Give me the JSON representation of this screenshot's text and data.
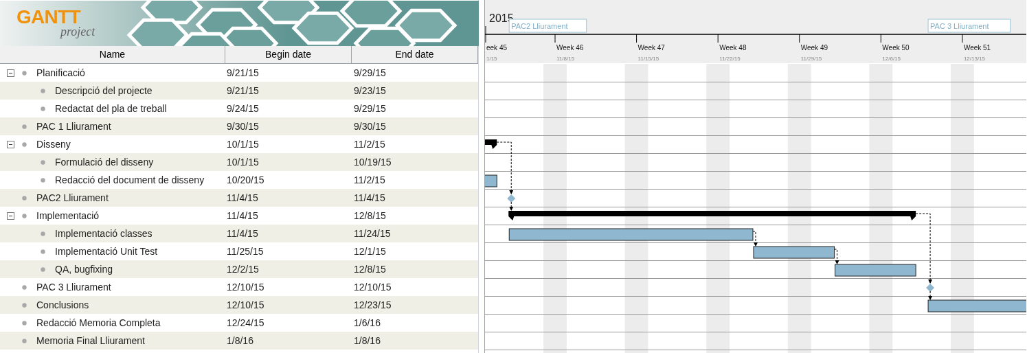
{
  "logo": {
    "word": "GANTT",
    "subword": "project"
  },
  "table": {
    "columns": [
      "Name",
      "Begin date",
      "End date"
    ],
    "tasks": [
      {
        "name": "Planificació",
        "begin": "9/21/15",
        "end": "9/29/15",
        "kind": "summary",
        "expanded": true,
        "has_predecessor": false,
        "children": [
          {
            "name": "Descripció del projecte",
            "begin": "9/21/15",
            "end": "9/23/15",
            "kind": "task",
            "has_predecessor": false
          },
          {
            "name": "Redactat del pla de treball",
            "begin": "9/24/15",
            "end": "9/29/15",
            "kind": "task",
            "has_predecessor": false
          }
        ]
      },
      {
        "name": "PAC 1 Lliurament",
        "begin": "9/30/15",
        "end": "9/30/15",
        "kind": "milestone",
        "has_predecessor": false
      },
      {
        "name": "Disseny",
        "begin": "10/1/15",
        "end": "11/2/15",
        "kind": "summary",
        "expanded": true,
        "has_predecessor": false,
        "children": [
          {
            "name": "Formulació del disseny",
            "begin": "10/1/15",
            "end": "10/19/15",
            "kind": "task",
            "has_predecessor": false
          },
          {
            "name": "Redacció del document de disseny",
            "begin": "10/20/15",
            "end": "11/2/15",
            "kind": "task",
            "has_predecessor": false
          }
        ]
      },
      {
        "name": "PAC2 Lliurament",
        "begin": "11/4/15",
        "end": "11/4/15",
        "kind": "milestone",
        "has_predecessor": true,
        "header_label": "PAC2 Lliurament"
      },
      {
        "name": "Implementació",
        "begin": "11/4/15",
        "end": "12/8/15",
        "kind": "summary",
        "expanded": true,
        "has_predecessor": true,
        "children": [
          {
            "name": "Implementació classes",
            "begin": "11/4/15",
            "end": "11/24/15",
            "kind": "task",
            "has_predecessor": false
          },
          {
            "name": "Implementació Unit Test",
            "begin": "11/25/15",
            "end": "12/1/15",
            "kind": "task",
            "has_predecessor": true
          },
          {
            "name": "QA, bugfixing",
            "begin": "12/2/15",
            "end": "12/8/15",
            "kind": "task",
            "has_predecessor": true
          }
        ]
      },
      {
        "name": "PAC 3 Lliurament",
        "begin": "12/10/15",
        "end": "12/10/15",
        "kind": "milestone",
        "has_predecessor": true,
        "header_label": "PAC 3 Lliurament"
      },
      {
        "name": "Conclusions",
        "begin": "12/10/15",
        "end": "12/23/15",
        "kind": "task",
        "has_predecessor": true
      },
      {
        "name": "Redacció Memoria Completa",
        "begin": "12/24/15",
        "end": "1/6/16",
        "kind": "task",
        "has_predecessor": false
      },
      {
        "name": "Memoria Final Lliurament",
        "begin": "1/8/16",
        "end": "1/8/16",
        "kind": "milestone",
        "has_predecessor": false
      }
    ]
  },
  "timeline": {
    "year": "2015",
    "weeks": [
      {
        "label": "eek 45",
        "date": "1/15"
      },
      {
        "label": "Week 46",
        "date": "11/8/15"
      },
      {
        "label": "Week 47",
        "date": "11/15/15"
      },
      {
        "label": "Week 48",
        "date": "11/22/15"
      },
      {
        "label": "Week 49",
        "date": "11/29/15"
      },
      {
        "label": "Week 50",
        "date": "12/6/15"
      },
      {
        "label": "Week 51",
        "date": "12/13/15"
      }
    ]
  }
}
